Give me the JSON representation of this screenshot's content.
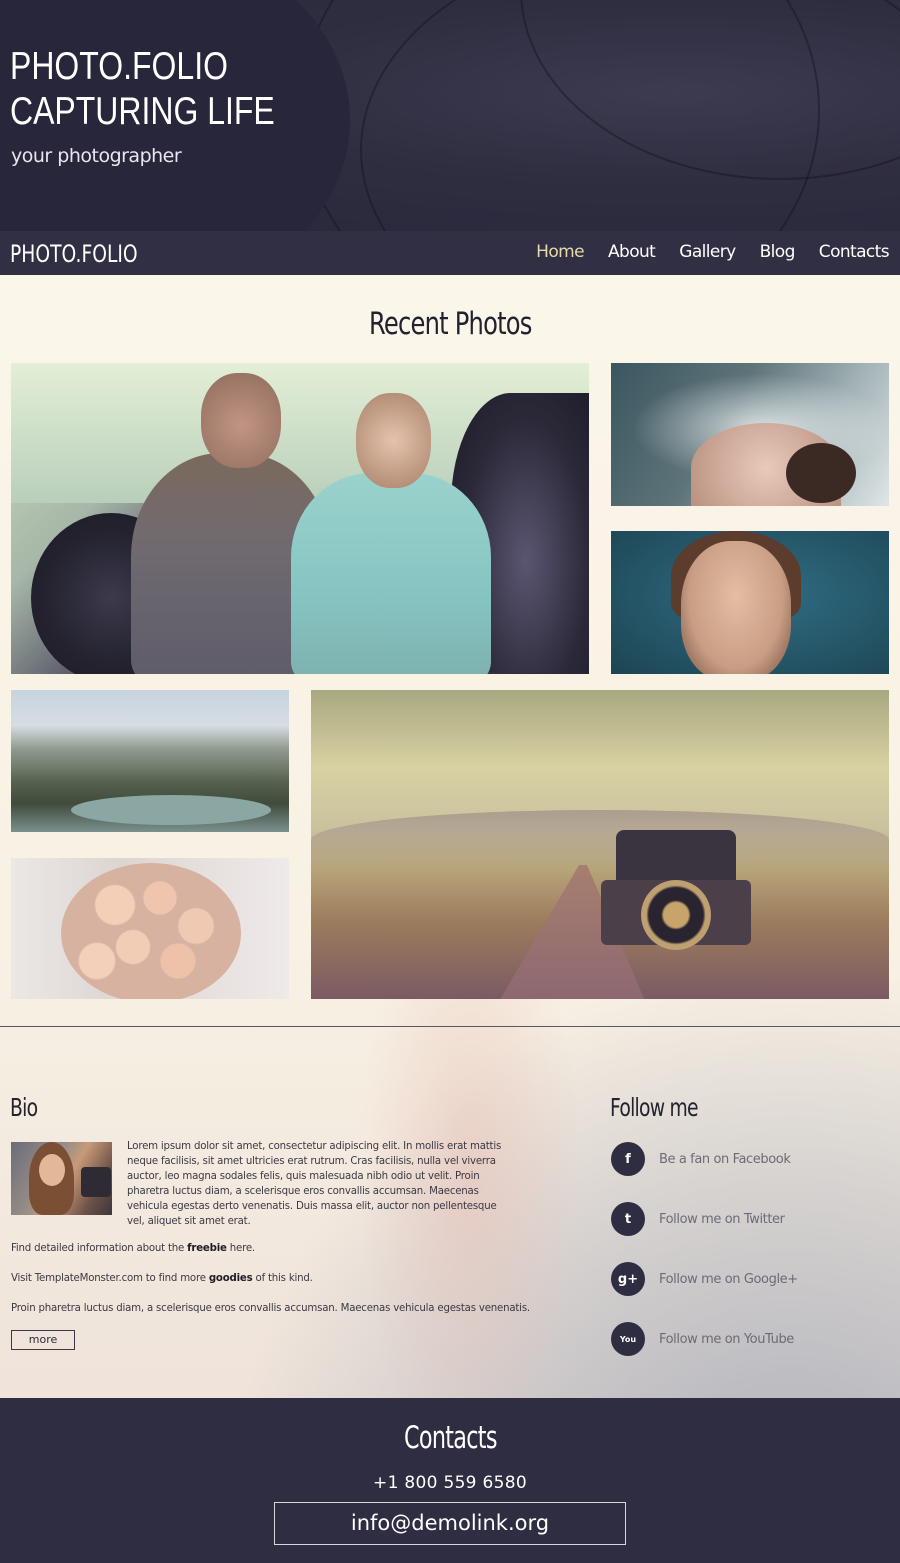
{
  "header": {
    "title_line1": "PHOTO.FOLIO",
    "title_line2": "CAPTURING LIFE",
    "subtitle": "your photographer"
  },
  "nav": {
    "logo": "PHOTO.FOLIO",
    "items": [
      {
        "label": "Home",
        "active": true
      },
      {
        "label": "About",
        "active": false
      },
      {
        "label": "Gallery",
        "active": false
      },
      {
        "label": "Blog",
        "active": false
      },
      {
        "label": "Contacts",
        "active": false
      }
    ]
  },
  "recent": {
    "title": "Recent Photos"
  },
  "bio": {
    "title": "Bio",
    "paragraph": "Lorem ipsum dolor sit amet, consectetur adipiscing elit. In mollis erat mattis neque facilisis, sit amet ultricies erat rutrum. Cras facilisis, nulla vel viverra auctor, leo magna sodales felis, quis malesuada nibh odio ut velit. Proin pharetra luctus diam, a scelerisque eros convallis accumsan. Maecenas vehicula egestas derto venenatis. Duis massa elit, auctor non pellentesque vel, aliquet sit amet erat.",
    "line1_pre": "Find detailed information about the ",
    "line1_bold": "freebie",
    "line1_post": " here.",
    "line2_pre": "Visit TemplateMonster.com to find more ",
    "line2_bold": "goodies",
    "line2_post": " of this kind.",
    "line3": "Proin pharetra luctus diam, a scelerisque eros convallis accumsan. Maecenas vehicula egestas venenatis.",
    "more_label": "more"
  },
  "follow": {
    "title": "Follow me",
    "items": [
      {
        "icon": "facebook-icon",
        "glyph": "f",
        "label": "Be a fan on Facebook"
      },
      {
        "icon": "twitter-icon",
        "glyph": "t",
        "label": "Follow me on Twitter"
      },
      {
        "icon": "google-plus-icon",
        "glyph": "g+",
        "label": "Follow me on Google+"
      },
      {
        "icon": "youtube-icon",
        "glyph": "You",
        "label": "Follow me on YouTube"
      }
    ]
  },
  "footer": {
    "title": "Contacts",
    "phone": "+1 800 559 6580",
    "email": "info@demolink.org"
  },
  "colors": {
    "dark": "#2f2d42",
    "nav_active": "#e6dcab",
    "background": "#fbf6ea"
  }
}
